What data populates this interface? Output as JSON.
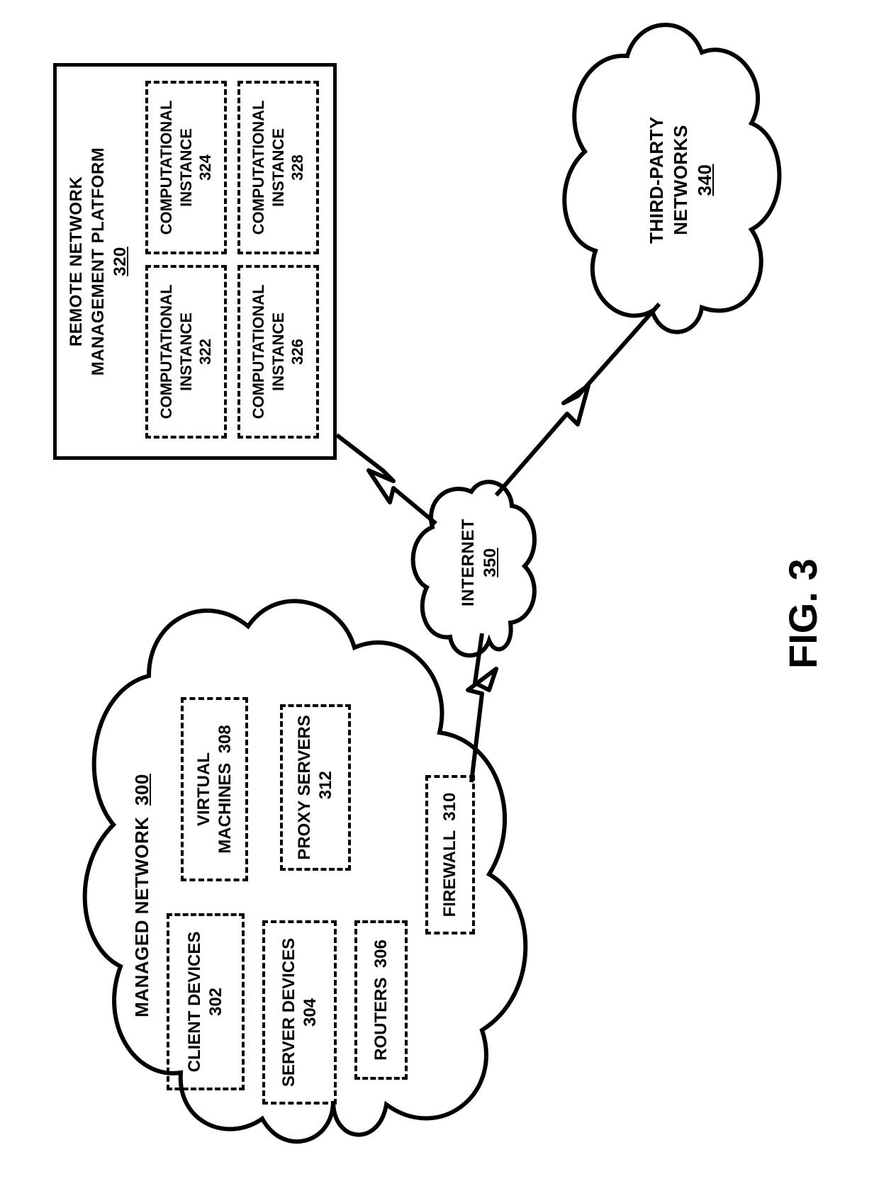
{
  "figure_label": "FIG. 3",
  "managed_network": {
    "title": "MANAGED NETWORK",
    "ref": "300",
    "client_devices": {
      "label": "CLIENT DEVICES",
      "ref": "302"
    },
    "server_devices": {
      "label": "SERVER DEVICES",
      "ref": "304"
    },
    "routers": {
      "label": "ROUTERS",
      "ref": "306"
    },
    "virtual_machines": {
      "label": "VIRTUAL MACHINES",
      "ref": "308"
    },
    "proxy_servers": {
      "label": "PROXY SERVERS",
      "ref": "312"
    },
    "firewall": {
      "label": "FIREWALL",
      "ref": "310"
    }
  },
  "remote_platform": {
    "title_line1": "REMOTE NETWORK",
    "title_line2": "MANAGEMENT PLATFORM",
    "ref": "320",
    "ci322": {
      "label": "COMPUTATIONAL INSTANCE",
      "ref": "322"
    },
    "ci324": {
      "label": "COMPUTATIONAL INSTANCE",
      "ref": "324"
    },
    "ci326": {
      "label": "COMPUTATIONAL INSTANCE",
      "ref": "326"
    },
    "ci328": {
      "label": "COMPUTATIONAL INSTANCE",
      "ref": "328"
    }
  },
  "internet": {
    "label": "INTERNET",
    "ref": "350"
  },
  "third_party": {
    "label_line1": "THIRD-PARTY",
    "label_line2": "NETWORKS",
    "ref": "340"
  }
}
